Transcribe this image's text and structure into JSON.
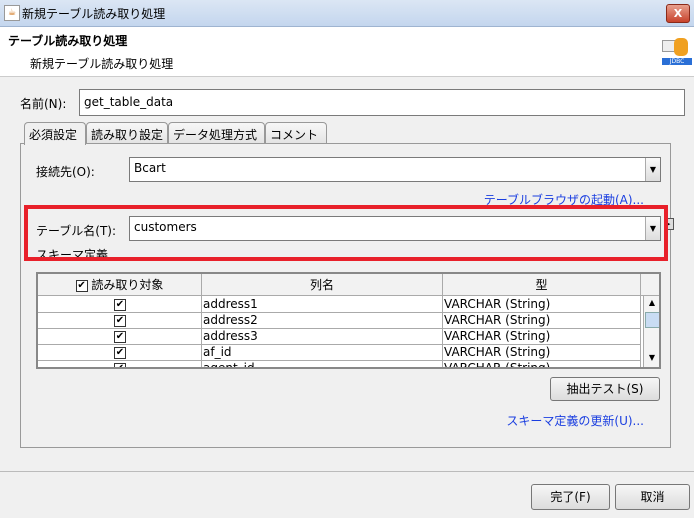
{
  "window": {
    "title": "新規テーブル読み取り処理",
    "close_label": "X"
  },
  "header": {
    "title": "テーブル読み取り処理",
    "subtitle": "新規テーブル読み取り処理",
    "icon_label": "JDBC"
  },
  "name": {
    "label": "名前(N):",
    "value": "get_table_data"
  },
  "tabs": [
    {
      "label": "必須設定"
    },
    {
      "label": "読み取り設定"
    },
    {
      "label": "データ処理方式"
    },
    {
      "label": "コメント"
    }
  ],
  "connection": {
    "label": "接続先(O):",
    "value": "Bcart",
    "browser_link": "テーブルブラウザの起動(A)..."
  },
  "table_name": {
    "label": "テーブル名(T):",
    "value": "customers"
  },
  "schema": {
    "label": "スキーマ定義",
    "columns": [
      "読み取り対象",
      "列名",
      "型"
    ],
    "rows": [
      {
        "checked": true,
        "name": "address1",
        "type": "VARCHAR (String)"
      },
      {
        "checked": true,
        "name": "address2",
        "type": "VARCHAR (String)"
      },
      {
        "checked": true,
        "name": "address3",
        "type": "VARCHAR (String)"
      },
      {
        "checked": true,
        "name": "af_id",
        "type": "VARCHAR (String)"
      },
      {
        "checked": true,
        "name": "agent_id",
        "type": "VARCHAR (String)"
      }
    ]
  },
  "buttons": {
    "extract_test": "抽出テスト(S)",
    "update_schema": "スキーマ定義の更新(U)...",
    "finish": "完了(F)",
    "cancel": "取消"
  }
}
